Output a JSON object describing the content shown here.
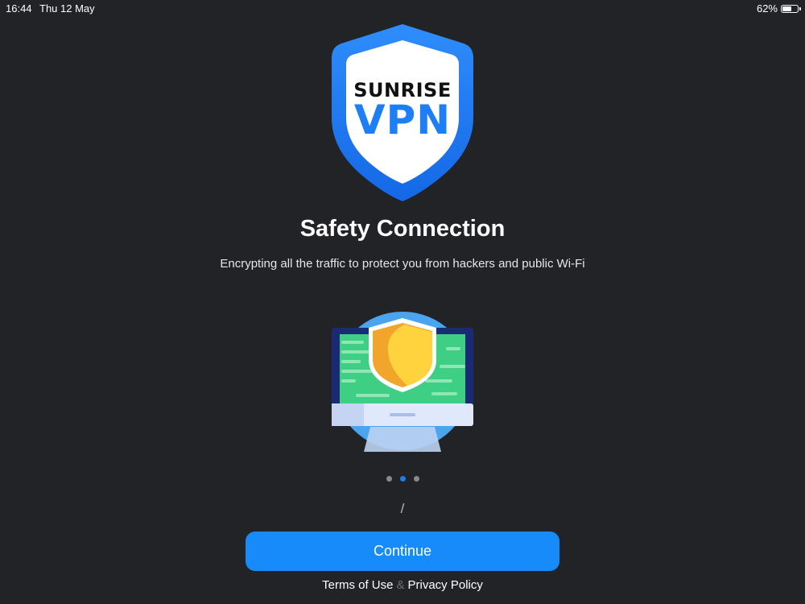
{
  "status_bar": {
    "time": "16:44",
    "date": "Thu 12 May",
    "battery": "62%",
    "battery_level": 0.62
  },
  "logo": {
    "line1": "SUNRISE",
    "line2": "VPN",
    "icon": "shield-logo-icon"
  },
  "onboarding": {
    "title": "Safety Connection",
    "description": "Encrypting all the traffic to protect you from hackers and public Wi-Fi",
    "illustration_icon": "monitor-shield-icon",
    "page_count": 3,
    "current_page": 2,
    "separator": "/"
  },
  "continue_label": "Continue",
  "footer": {
    "terms_label": "Terms of Use",
    "ampersand": "&",
    "privacy_label": "Privacy Policy"
  },
  "colors": {
    "background": "#222327",
    "accent": "#168bf9",
    "vpn_blue": "#1e7ef6"
  }
}
